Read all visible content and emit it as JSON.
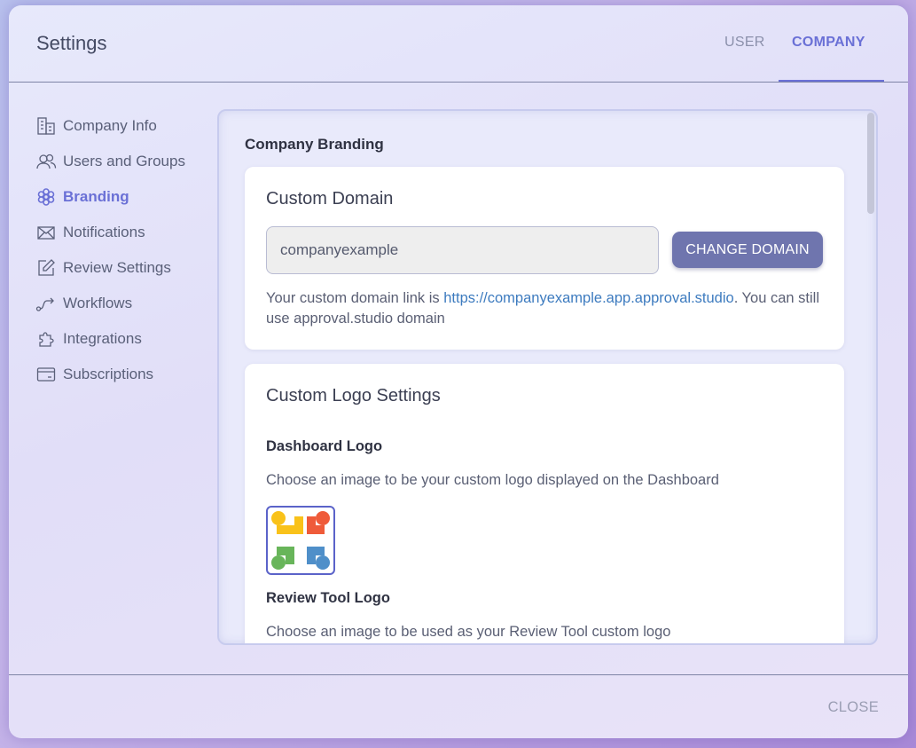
{
  "header": {
    "title": "Settings",
    "tabs": [
      {
        "label": "USER",
        "active": false
      },
      {
        "label": "COMPANY",
        "active": true
      }
    ]
  },
  "sidebar": {
    "items": [
      {
        "label": "Company Info",
        "icon": "building-icon",
        "active": false
      },
      {
        "label": "Users and Groups",
        "icon": "users-icon",
        "active": false
      },
      {
        "label": "Branding",
        "icon": "flower-icon",
        "active": true
      },
      {
        "label": "Notifications",
        "icon": "envelope-icon",
        "active": false
      },
      {
        "label": "Review Settings",
        "icon": "edit-icon",
        "active": false
      },
      {
        "label": "Workflows",
        "icon": "workflow-icon",
        "active": false
      },
      {
        "label": "Integrations",
        "icon": "puzzle-icon",
        "active": false
      },
      {
        "label": "Subscriptions",
        "icon": "card-icon",
        "active": false
      }
    ]
  },
  "main": {
    "section_title": "Company Branding",
    "custom_domain": {
      "title": "Custom Domain",
      "input_value": "companyexample",
      "button_label": "CHANGE DOMAIN",
      "note_prefix": "Your custom domain link is ",
      "note_link": "https://companyexample.app.approval.studio",
      "note_suffix": ". You can still use approval.studio domain"
    },
    "custom_logo": {
      "title": "Custom Logo Settings",
      "dashboard_logo_title": "Dashboard Logo",
      "dashboard_logo_desc": "Choose an image to be your custom logo displayed on the Dashboard",
      "review_logo_title": "Review Tool Logo",
      "review_logo_desc": "Choose an image to be used as your Review Tool custom logo"
    }
  },
  "footer": {
    "close_label": "CLOSE"
  },
  "colors": {
    "accent": "#6a70d6",
    "button": "#6f75ae",
    "link": "#3d7bbf"
  }
}
